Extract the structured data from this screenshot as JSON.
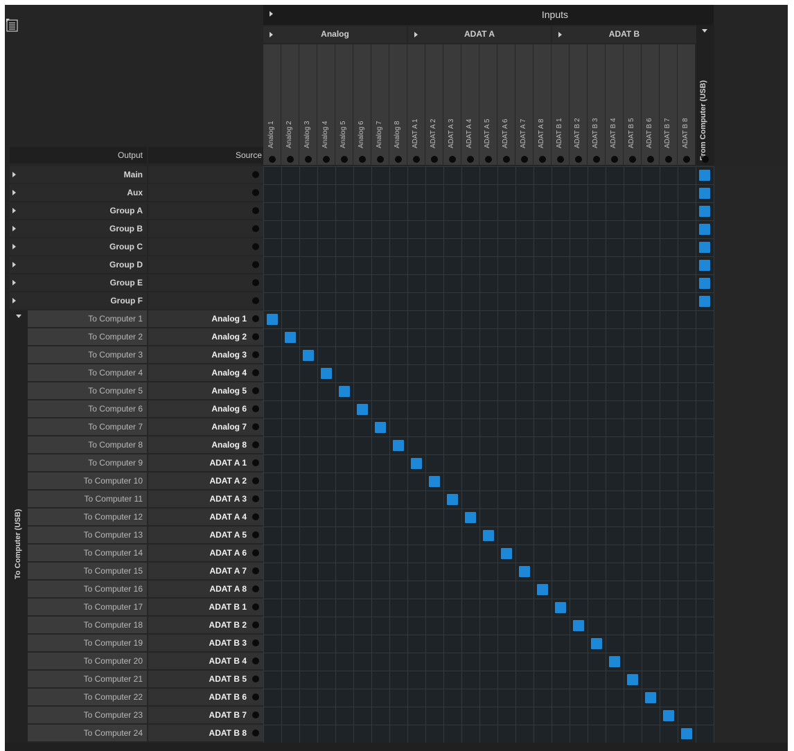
{
  "header": {
    "inputs_title": "Inputs",
    "output_label": "Output",
    "source_label": "Source",
    "groups": [
      "Analog",
      "ADAT A",
      "ADAT B"
    ],
    "from_computer_label": "From Computer (USB)",
    "to_computer_label": "To Computer (USB)"
  },
  "input_channels": [
    "Analog 1",
    "Analog 2",
    "Analog 3",
    "Analog 4",
    "Analog 5",
    "Analog 6",
    "Analog 7",
    "Analog 8",
    "ADAT A 1",
    "ADAT A 2",
    "ADAT A 3",
    "ADAT A 4",
    "ADAT A 5",
    "ADAT A 6",
    "ADAT A 7",
    "ADAT A 8",
    "ADAT B 1",
    "ADAT B 2",
    "ADAT B 3",
    "ADAT B 4",
    "ADAT B 5",
    "ADAT B 6",
    "ADAT B 7",
    "ADAT B 8"
  ],
  "mix_outputs": [
    "Main",
    "Aux",
    "Group A",
    "Group B",
    "Group C",
    "Group D",
    "Group E",
    "Group F"
  ],
  "computer_outputs": [
    {
      "name": "To Computer 1",
      "source": "Analog 1"
    },
    {
      "name": "To Computer 2",
      "source": "Analog 2"
    },
    {
      "name": "To Computer 3",
      "source": "Analog 3"
    },
    {
      "name": "To Computer 4",
      "source": "Analog 4"
    },
    {
      "name": "To Computer 5",
      "source": "Analog 5"
    },
    {
      "name": "To Computer 6",
      "source": "Analog 6"
    },
    {
      "name": "To Computer 7",
      "source": "Analog 7"
    },
    {
      "name": "To Computer 8",
      "source": "Analog 8"
    },
    {
      "name": "To Computer 9",
      "source": "ADAT A 1"
    },
    {
      "name": "To Computer 10",
      "source": "ADAT A 2"
    },
    {
      "name": "To Computer 11",
      "source": "ADAT A 3"
    },
    {
      "name": "To Computer 12",
      "source": "ADAT A 4"
    },
    {
      "name": "To Computer 13",
      "source": "ADAT A 5"
    },
    {
      "name": "To Computer 14",
      "source": "ADAT A 6"
    },
    {
      "name": "To Computer 15",
      "source": "ADAT A 7"
    },
    {
      "name": "To Computer 16",
      "source": "ADAT A 8"
    },
    {
      "name": "To Computer 17",
      "source": "ADAT B 1"
    },
    {
      "name": "To Computer 18",
      "source": "ADAT B 2"
    },
    {
      "name": "To Computer 19",
      "source": "ADAT B 3"
    },
    {
      "name": "To Computer 20",
      "source": "ADAT B 4"
    },
    {
      "name": "To Computer 21",
      "source": "ADAT B 5"
    },
    {
      "name": "To Computer 22",
      "source": "ADAT B 6"
    },
    {
      "name": "To Computer 23",
      "source": "ADAT B 7"
    },
    {
      "name": "To Computer 24",
      "source": "ADAT B 8"
    }
  ],
  "routing": {
    "mix_outputs_source": "From Computer (USB)",
    "computer_outputs_mode": "one-to-one"
  },
  "colors": {
    "active_route": "#1e88d8",
    "background": "#252525",
    "grid": "#1d2326"
  },
  "icons": {
    "menu": "list-menu-icon",
    "expand": "triangle-right-icon",
    "collapse": "triangle-down-icon",
    "port": "port-dot-icon"
  }
}
